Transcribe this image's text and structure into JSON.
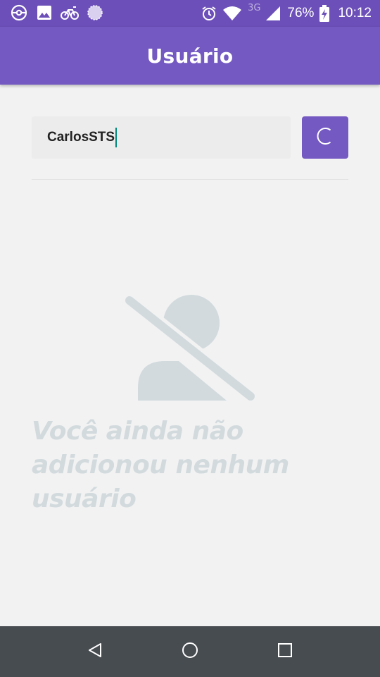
{
  "status_bar": {
    "left_icons": [
      "pokeball-icon",
      "image-icon",
      "cycling-icon",
      "sphere-icon"
    ],
    "network_label": "3G",
    "battery_percent": "76%",
    "time": "10:12"
  },
  "app_bar": {
    "title": "Usuário"
  },
  "search": {
    "value": "CarlosSTS",
    "button_icon": "refresh-icon"
  },
  "empty_state": {
    "icon": "user-off-icon",
    "message": "Você ainda não adicionou nenhum usuário"
  },
  "nav_bar": {
    "buttons": [
      "back-icon",
      "home-icon",
      "recents-icon"
    ]
  },
  "colors": {
    "status_bar": "#6c4fb8",
    "app_bar": "#7459c2",
    "accent": "#7459c2",
    "caret": "#00897b",
    "empty_text": "#d2dade",
    "background": "#f2f2f2",
    "nav_bar": "#474c51"
  }
}
